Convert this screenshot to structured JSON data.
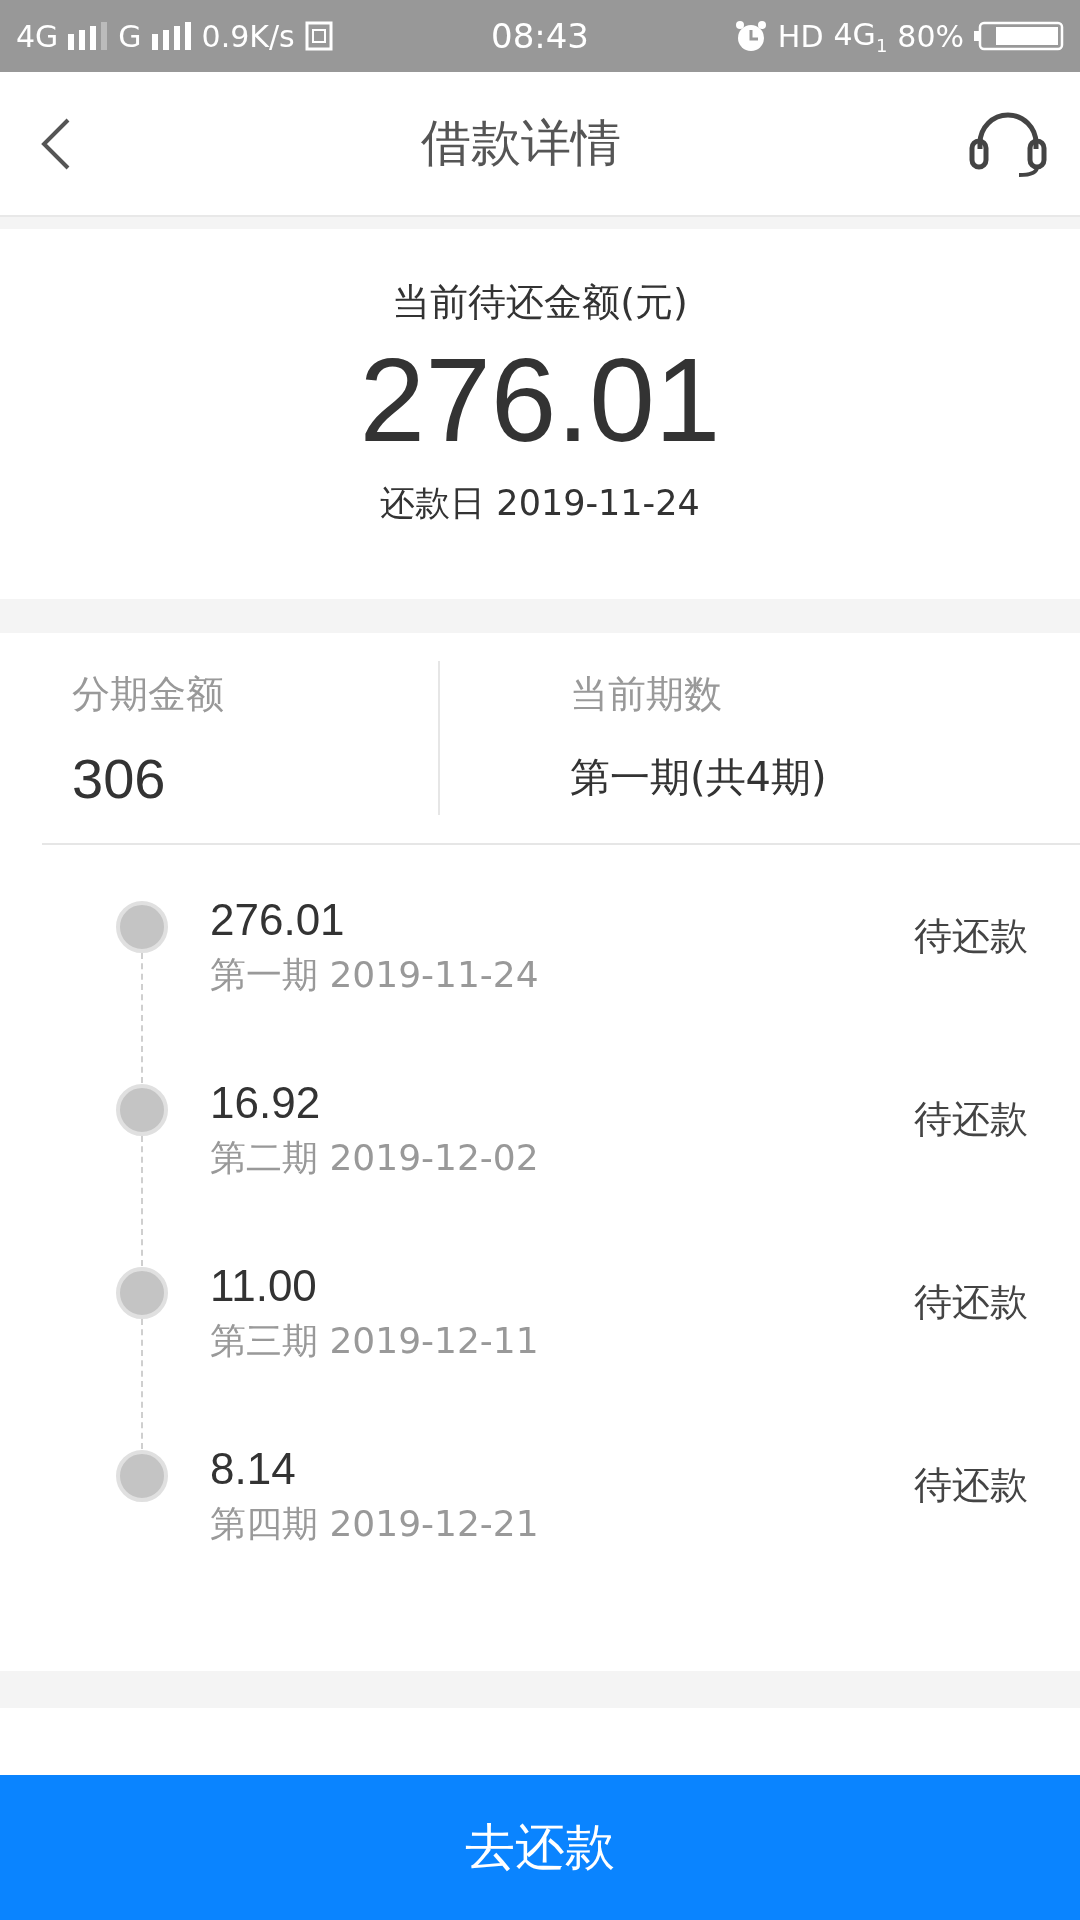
{
  "status_bar": {
    "left": [
      "4G",
      "G",
      "0.9K/s"
    ],
    "time": "08:43",
    "network": "HD",
    "network_type": "4G",
    "sim": "1",
    "battery": "80%"
  },
  "header": {
    "title": "借款详情"
  },
  "summary": {
    "label": "当前待还金额(元)",
    "amount": "276.01",
    "due_label": "还款日 2019-11-24"
  },
  "info": [
    {
      "label": "分期金额",
      "value": "306"
    },
    {
      "label": "当前期数",
      "value": "第一期(共4期)"
    }
  ],
  "installments": [
    {
      "amount": "276.01",
      "period": "第一期 2019-11-24",
      "status": "待还款"
    },
    {
      "amount": "16.92",
      "period": "第二期 2019-12-02",
      "status": "待还款"
    },
    {
      "amount": "11.00",
      "period": "第三期 2019-12-11",
      "status": "待还款"
    },
    {
      "amount": "8.14",
      "period": "第四期 2019-12-21",
      "status": "待还款"
    }
  ],
  "pay_button": "去还款"
}
